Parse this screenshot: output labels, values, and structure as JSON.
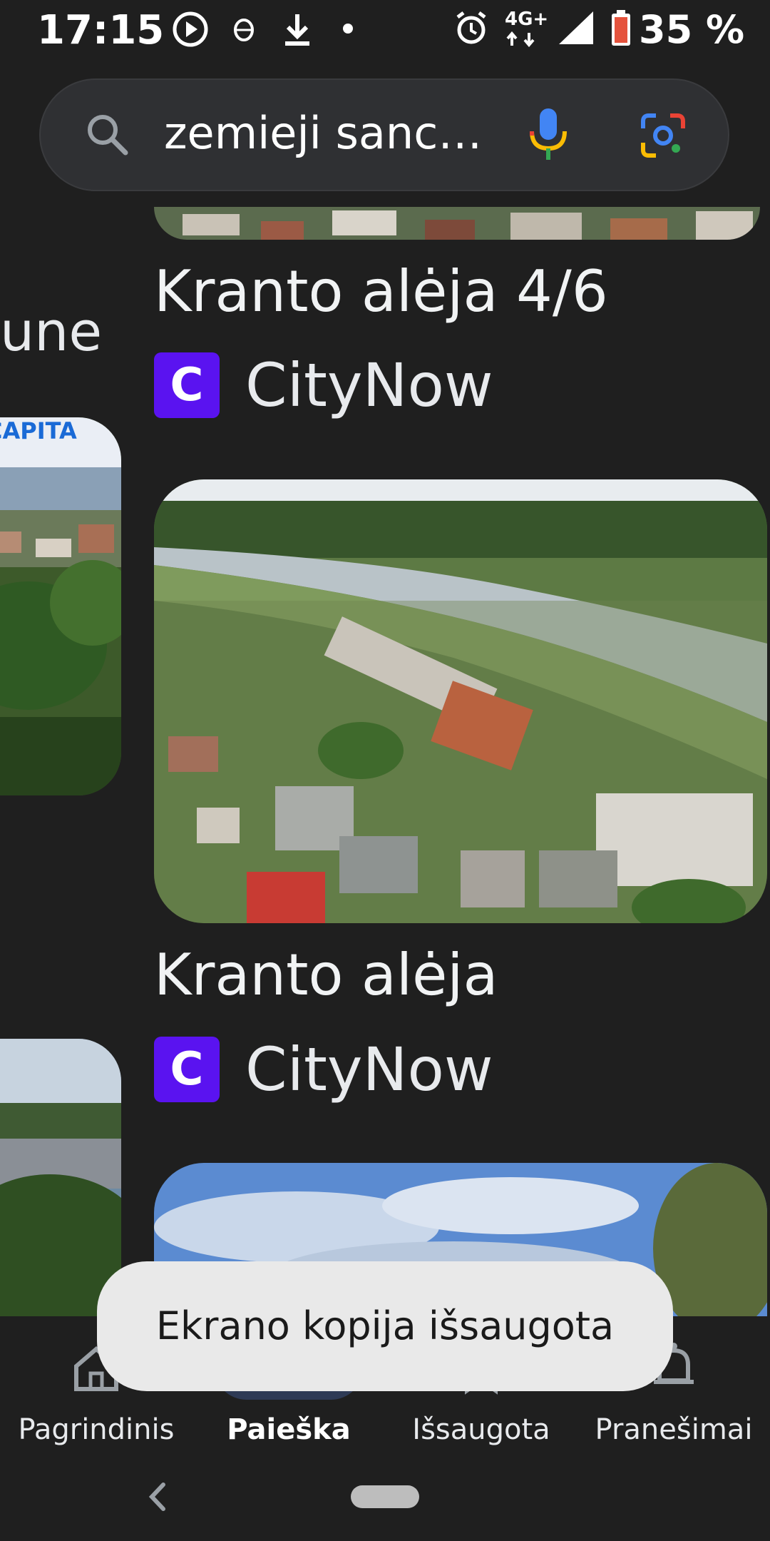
{
  "status_bar": {
    "time": "17:15",
    "network": "4G+",
    "battery": "35 %",
    "icons": [
      "play-circle-icon",
      "cloud-bug-icon",
      "download-icon",
      "dot-icon",
      "alarm-icon",
      "network-4g-icon",
      "signal-icon",
      "battery-icon"
    ]
  },
  "search": {
    "query": "zemieji sanc…",
    "icons": [
      "search-icon",
      "mic-icon",
      "lens-icon"
    ]
  },
  "left_column": {
    "partial_title": "une",
    "partial_banner_text": "CAPITA"
  },
  "results": [
    {
      "title": "Kranto alėja 4/6",
      "source_logo": "C",
      "source_name": "CityNow"
    },
    {
      "title": "Kranto alėja",
      "source_logo": "C",
      "source_name": "CityNow"
    }
  ],
  "bottom_nav": {
    "items": [
      {
        "label": "Pagrindinis",
        "icon": "home-icon",
        "active": false
      },
      {
        "label": "Paieška",
        "icon": "search-icon",
        "active": true
      },
      {
        "label": "Išsaugota",
        "icon": "bookmark-icon",
        "active": false
      },
      {
        "label": "Pranešimai",
        "icon": "bell-icon",
        "active": false
      }
    ]
  },
  "toast": {
    "message": "Ekrano kopija išsaugota"
  },
  "colors": {
    "background": "#1f1f1f",
    "search_bar": "#2f3033",
    "source_logo": "#5a13f0",
    "toast_bg": "#e9e9e9"
  }
}
